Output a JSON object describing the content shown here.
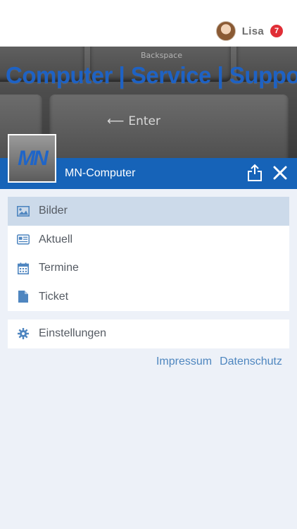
{
  "user": {
    "name": "Lisa",
    "notification_count": "7"
  },
  "hero": {
    "banner_text": "Computer | Service | Support",
    "key_backspace": "Backspace",
    "key_enter": "Enter"
  },
  "logo": {
    "text": "MN"
  },
  "header": {
    "company_name": "MN-Computer"
  },
  "menu": {
    "items": [
      {
        "label": "Bilder",
        "icon": "image-icon"
      },
      {
        "label": "Aktuell",
        "icon": "newspaper-icon"
      },
      {
        "label": "Termine",
        "icon": "calendar-icon"
      },
      {
        "label": "Ticket",
        "icon": "document-icon"
      }
    ],
    "active_item": "Bilder"
  },
  "settings": {
    "label": "Einstellungen",
    "icon": "gear-icon"
  },
  "footer": {
    "impressum": "Impressum",
    "datenschutz": "Datenschutz"
  },
  "colors": {
    "brand_blue": "#1663b8",
    "active_bg": "#ccdaea",
    "badge_red": "#e02e36",
    "link": "#4e86bf",
    "icon": "#4f86c0"
  }
}
